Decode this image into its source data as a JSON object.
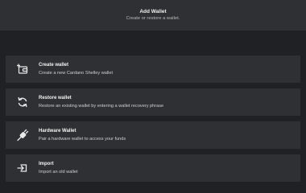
{
  "header": {
    "title": "Add Wallet",
    "subtitle": "Create or restore a wallet."
  },
  "options": [
    {
      "icon": "create-wallet-icon",
      "title": "Create wallet",
      "description": "Create a new Cardano Shelley wallet"
    },
    {
      "icon": "restore-icon",
      "title": "Restore wallet",
      "description": "Restore an existing wallet by entering a wallet recovery phrase"
    },
    {
      "icon": "hardware-plug-icon",
      "title": "Hardware Wallet",
      "description": "Pair a hardware wallet to access your funds"
    },
    {
      "icon": "import-icon",
      "title": "Import",
      "description": "Import an old wallet"
    }
  ],
  "colors": {
    "background": "#202124",
    "panel": "#2f3033",
    "text": "#f2f2f2",
    "muted": "#b9b9b9"
  }
}
